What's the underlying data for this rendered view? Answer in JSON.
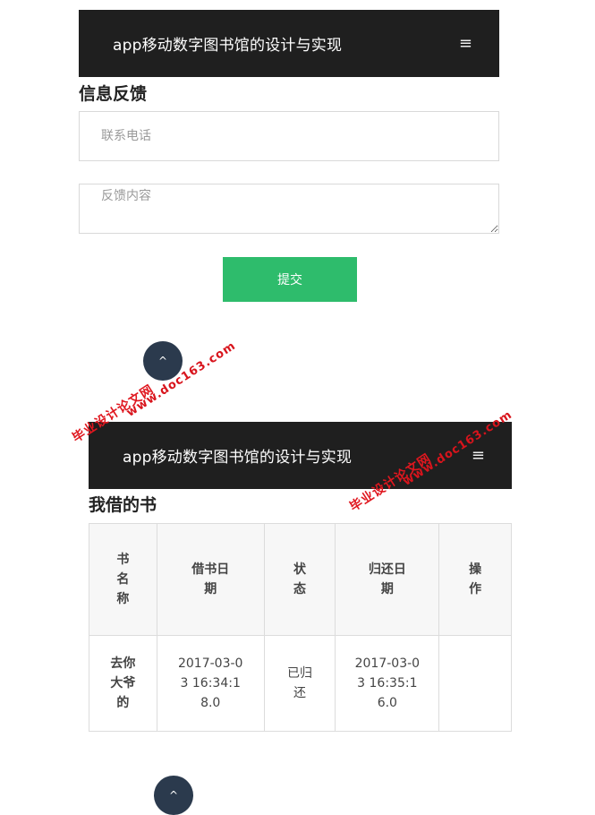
{
  "screen1": {
    "brand": "app移动数字图书馆的设计与实现",
    "menu_icon": "≡",
    "title": "信息反馈",
    "phone_placeholder": "联系电话",
    "content_placeholder": "反馈内容",
    "submit_label": "提交",
    "back_to_top_icon": "^"
  },
  "screen2": {
    "brand": "app移动数字图书馆的设计与实现",
    "menu_icon": "≡",
    "title": "我借的书",
    "table": {
      "headers": [
        "书名称",
        "借书日期",
        "状态",
        "归还日期",
        "操作"
      ],
      "rows": [
        {
          "book_name": "去你大爷的",
          "borrow_date": "2017-03-03 16:34:18.0",
          "status": "已归还",
          "return_date": "2017-03-03 16:35:16.0",
          "action": ""
        }
      ]
    },
    "back_to_top_icon": "^"
  },
  "watermarks": {
    "site_cn": "毕业设计论文网",
    "site_url": "www.doc163.com"
  }
}
